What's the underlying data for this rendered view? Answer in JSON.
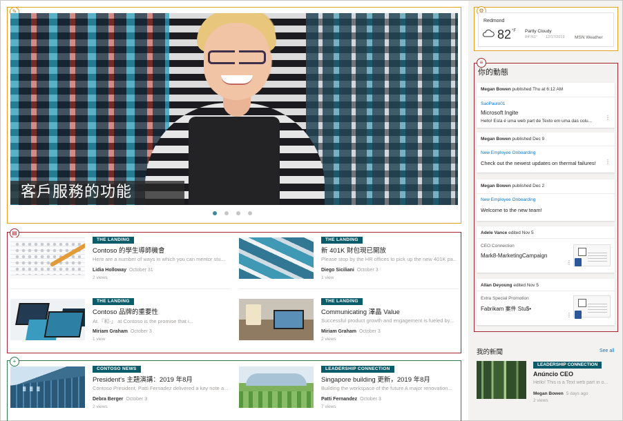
{
  "hero": {
    "title": "客戶服務的功能",
    "page_count": 4,
    "active_page": 1
  },
  "news_top": [
    {
      "tag": "THE LANDING",
      "title": "Contoso 的學生導師機會",
      "desc": "Here are a number of ways in which you can mentor stu...",
      "author": "Lidia Holloway",
      "date": "October 31",
      "views": "2 views",
      "thumb": "exam-sheet"
    },
    {
      "tag": "THE LANDING",
      "title": "新 401K 財包現已開放",
      "desc": "Please stop by the HR offices to pick up the new 401K pa...",
      "author": "Diego Siciliani",
      "date": "October 3",
      "views": "1 view",
      "thumb": "business-cards"
    },
    {
      "tag": "THE LANDING",
      "title": "Contoso 品牌的重要性",
      "desc": "At 『和-」                    at Contoso is the promise that i...",
      "author": "Miriam Graham",
      "date": "October 3",
      "views": "1 view",
      "thumb": "devices"
    },
    {
      "tag": "THE LANDING",
      "title": "Communicating 澤晶        Value",
      "desc": "Successful product growth and engagement is fueled by...",
      "author": "Miriam Graham",
      "date": "October 3",
      "views": "2 views",
      "thumb": "desk"
    }
  ],
  "news_bottom": [
    {
      "tag": "CONTOSO NEWS",
      "title": "President's 主題演講：2019 年8月",
      "desc": "Contoso President, Patti Fernadez delivered a key note a...",
      "author": "Debra Berger",
      "date": "October 3",
      "views": "2 views",
      "thumb": "building"
    },
    {
      "tag": "LEADERSHIP CONNECTION",
      "title": "Singapore building 更新，2019 年8月",
      "desc": "Building the workspace of the future A major renovation...",
      "author": "Patti Fernandez",
      "date": "October 3",
      "views": "7 views",
      "thumb": "park"
    }
  ],
  "weather": {
    "city": "Redmond",
    "temp": "82",
    "unit": "°F",
    "condition": "Partly Cloudy",
    "range": "84°/61°",
    "date": "12/17/2019",
    "source": "MSN Weather"
  },
  "activity": {
    "title": "你的動態",
    "items": [
      {
        "who": "Megan Bowen",
        "action": "published Thu at 6:12 AM",
        "site": "SaoPaulo01",
        "doc": "Microsoft Ingite",
        "snippet": "Hello! Esta é uma web part de Texto em uma das colu..."
      },
      {
        "who": "Megan Bowen",
        "action": "published Dec 9",
        "site": "New Employee Onboarding",
        "snippet": "Check out the newest updates on thermal failures!"
      },
      {
        "who": "Megan Bowen",
        "action": "published Dec 2",
        "site": "New Employee Onboarding",
        "snippet": "Welcome to the new team!"
      },
      {
        "who": "Adele Vance",
        "action": "edited Nov 5",
        "site": "CEO Connection",
        "doc": "Mark8-MarketingCampaign"
      },
      {
        "who": "Allan Deyoung",
        "action": "edited Nov 5",
        "site": "Extra Special Promotion",
        "doc": "Fabrikam 案件 Stu$•"
      }
    ]
  },
  "my_news": {
    "title": "我的新聞",
    "see_all": "See all",
    "tag": "LEADERSHIP CONNECTION",
    "headline": "Anúncio CEO",
    "desc": "Hello! This is a Text web part in o...",
    "author": "Megan Bowen",
    "date": "5 days ago",
    "views": "2 views"
  },
  "colors": {
    "accent_teal": "#0b5c6b",
    "outline_gold": "#e3a21a",
    "outline_red": "#a4262c",
    "outline_green": "#2a7d4f",
    "link_blue": "#0078d4"
  }
}
